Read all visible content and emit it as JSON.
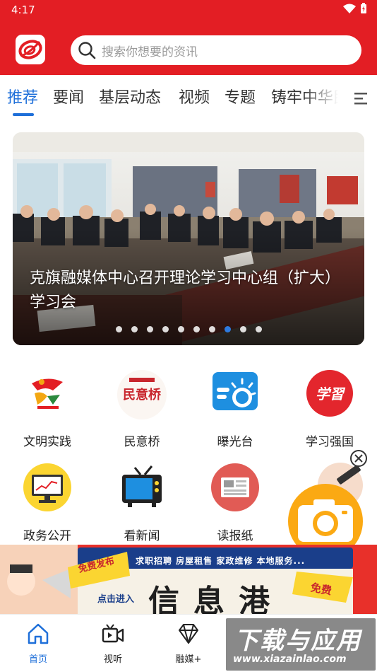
{
  "status_bar": {
    "time": "4:17"
  },
  "search": {
    "placeholder": "搜索你想要的资讯"
  },
  "tabs": [
    {
      "label": "推荐",
      "active": true
    },
    {
      "label": "要闻"
    },
    {
      "label": "基层动态"
    },
    {
      "label": "视频"
    },
    {
      "label": "专题"
    },
    {
      "label": "铸牢中华民"
    }
  ],
  "banner": {
    "caption": "克旗融媒体中心召开理论学习中心组（扩大）学习会",
    "slide_count": 10,
    "active_slide": 8
  },
  "grid": [
    {
      "label": "文明实践",
      "icon": "civilization-icon"
    },
    {
      "label": "民意桥",
      "icon": "bridge-logo-icon",
      "logo_text": "民意桥"
    },
    {
      "label": "曝光台",
      "icon": "spotlight-icon"
    },
    {
      "label": "学习强国",
      "icon": "study-icon",
      "logo_text": "学習"
    },
    {
      "label": "政务公开",
      "icon": "monitor-icon"
    },
    {
      "label": "看新闻",
      "icon": "tv-icon"
    },
    {
      "label": "读报纸",
      "icon": "newspaper-icon"
    }
  ],
  "promo": {
    "top_line": "求职招聘  房屋租售  家政维修  本地服务...",
    "title": "信息港",
    "badge_left": "免费发布",
    "badge_right": "免费",
    "sub": "点击进入"
  },
  "bottom_nav": [
    {
      "label": "首页",
      "icon": "home-icon",
      "active": true
    },
    {
      "label": "视听",
      "icon": "video-icon"
    },
    {
      "label": "融媒+",
      "icon": "diamond-icon"
    }
  ],
  "watermark": {
    "line1": "下载与应用",
    "line2": "www.xiazainlao.com"
  },
  "colors": {
    "header_red": "#e31e24",
    "accent_blue": "#1e6fd9",
    "promo_red": "#e8302a",
    "float_orange": "#fba913"
  }
}
